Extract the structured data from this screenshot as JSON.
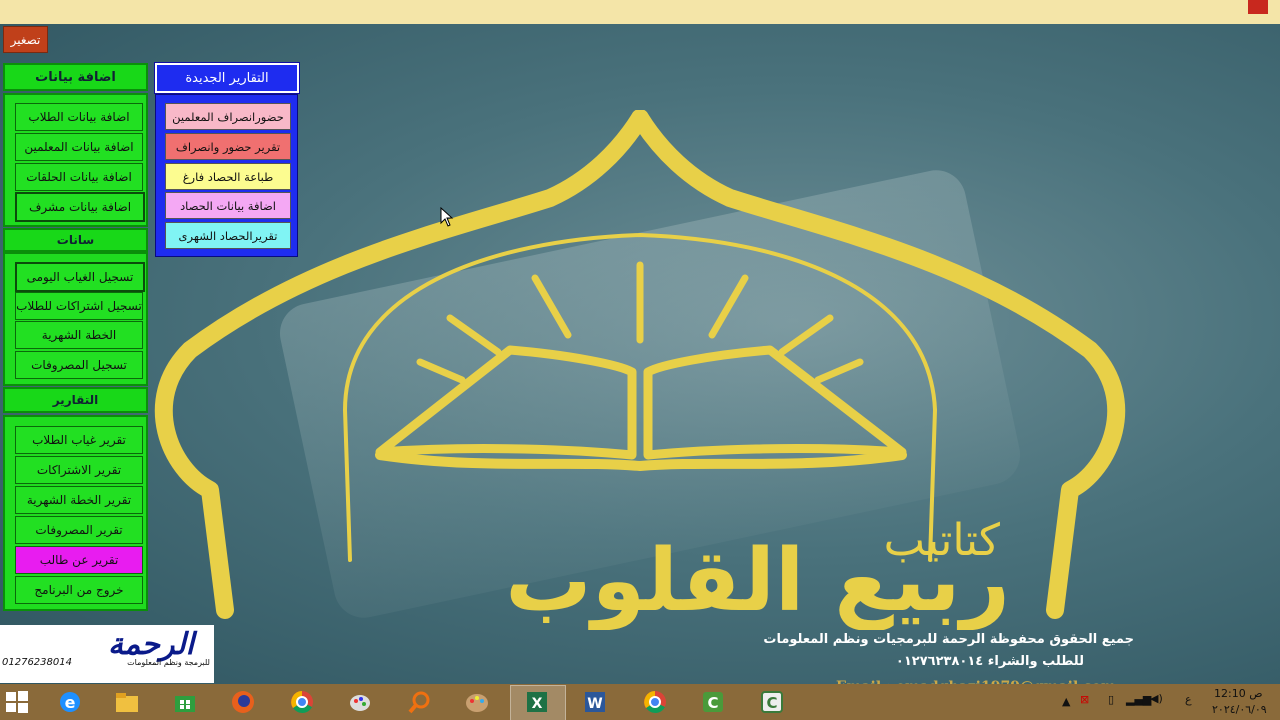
{
  "window": {
    "minimize_label": "تصغير"
  },
  "add_data": {
    "title": "اضافة بيانات",
    "buttons": [
      "اضافة بيانات الطلاب",
      "اضافة بيانات المعلمين",
      "اضافة بيانات الحلقات",
      "اضافة بيانات مشرف"
    ]
  },
  "data_section": {
    "title": "سانات",
    "buttons": [
      "تسجيل الغياب اليومى",
      "تسجيل اشتراكات للطلاب",
      "الخطة الشهرية",
      "تسجيل المصروفات"
    ]
  },
  "reports": {
    "title": "التقارير",
    "buttons": [
      "تقرير غياب الطلاب",
      "تقرير الاشتراكات",
      "تقرير الخطة الشهرية",
      "تقرير المصروفات",
      "تقرير عن طالب",
      "خروج من البرنامج"
    ]
  },
  "new_reports": {
    "title": "التقارير الجديدة",
    "buttons": [
      {
        "label": "حضورانصراف المعلمين",
        "color": "#f8b8c8"
      },
      {
        "label": "تقرير حضور وانصراف",
        "color": "#f07070"
      },
      {
        "label": "طباعة الحصاد فارغ",
        "color": "#fcfc90"
      },
      {
        "label": "اضافة بيانات الحصاد",
        "color": "#f4a8f4"
      },
      {
        "label": "تقريرالحصاد الشهرى",
        "color": "#80f4f4"
      }
    ]
  },
  "emblem": {
    "line1": "كتاتيب",
    "line2": "ربيع القلوب",
    "color": "#e8d048"
  },
  "logo": {
    "brand": "الرحمة",
    "phone": "01276238014",
    "tagline": "للبرمجة ونظم المعلومات"
  },
  "footer": {
    "line1": "جميع الحقوق محفوظة  الرحمة للبرمجيات ونظم المعلومات",
    "line2": "للطلب والشراء ٠١٢٧٦٢٣٨٠١٤",
    "email": "Email : emadghazi1979@gmail.com"
  },
  "taskbar": {
    "icons": [
      "windows-start-icon",
      "internet-explorer-icon",
      "file-explorer-icon",
      "store-icon",
      "firefox-icon",
      "chrome-icon",
      "paint-icon",
      "search-magnifier-icon",
      "palette-icon",
      "excel-icon",
      "word-icon",
      "chrome-icon",
      "camtasia-icon",
      "camtasia-recorder-icon"
    ],
    "lang": "ع",
    "time": "12:10 ص",
    "date": "٢٠٢٤/٠٦/٠٩"
  }
}
